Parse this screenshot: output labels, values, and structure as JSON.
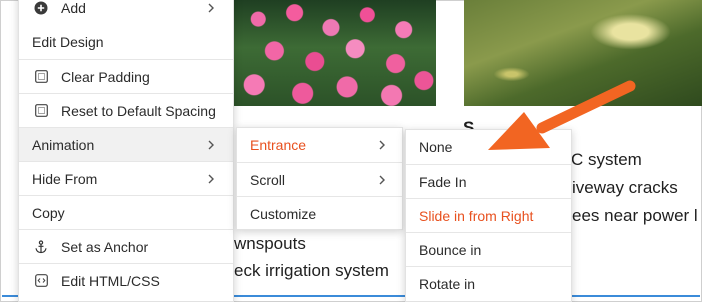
{
  "background": {
    "text_lines": [
      "C system",
      "iveway cracks",
      "ees near power l",
      "wnspouts",
      "eck irrigation system"
    ],
    "heading_fragment": "S"
  },
  "context_menu": {
    "items": [
      {
        "label": "Add",
        "icon": "plus-circle-icon",
        "has_submenu": true
      },
      {
        "label": "Edit Design",
        "icon": "",
        "has_submenu": false
      },
      {
        "label": "Clear Padding",
        "icon": "padding-box-icon",
        "has_submenu": false
      },
      {
        "label": "Reset to Default Spacing",
        "icon": "spacing-box-icon",
        "has_submenu": false
      },
      {
        "label": "Animation",
        "icon": "",
        "has_submenu": true
      },
      {
        "label": "Hide From",
        "icon": "",
        "has_submenu": true
      },
      {
        "label": "Copy",
        "icon": "",
        "has_submenu": false
      },
      {
        "label": "Set as Anchor",
        "icon": "anchor-icon",
        "has_submenu": false
      },
      {
        "label": "Edit HTML/CSS",
        "icon": "code-icon",
        "has_submenu": false
      }
    ]
  },
  "animation_submenu": {
    "items": [
      {
        "label": "Entrance",
        "has_submenu": true
      },
      {
        "label": "Scroll",
        "has_submenu": true
      },
      {
        "label": "Customize",
        "has_submenu": false
      }
    ]
  },
  "entrance_submenu": {
    "items": [
      {
        "label": "None"
      },
      {
        "label": "Fade In"
      },
      {
        "label": "Slide in from Right"
      },
      {
        "label": "Bounce in"
      },
      {
        "label": "Rotate in"
      }
    ]
  },
  "colors": {
    "accent": "#e8511f",
    "annotation_arrow": "#f26522",
    "hover_bg": "#f1f1f1",
    "bottom_line": "#3b8bd9"
  }
}
